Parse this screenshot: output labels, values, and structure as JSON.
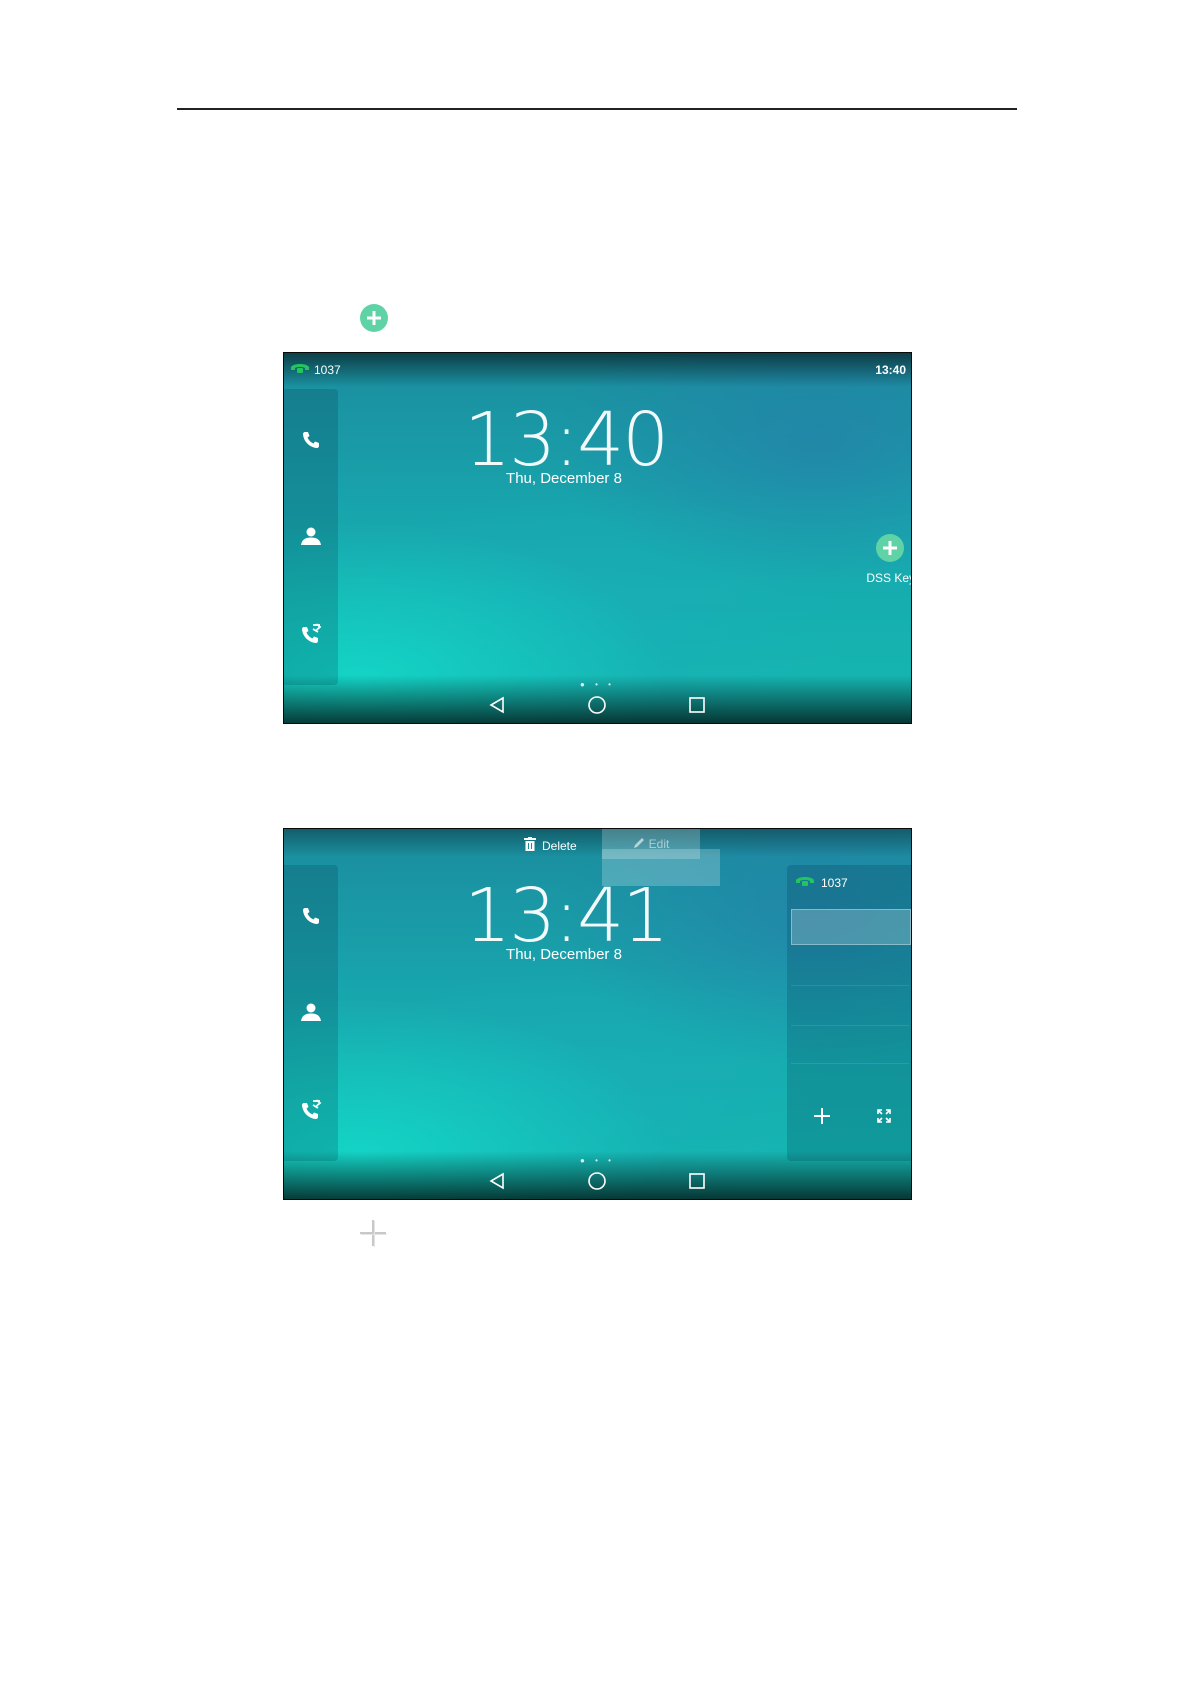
{
  "doc": {
    "inline_icon_1": "add-circle-icon",
    "inline_icon_2": "plus-icon"
  },
  "screen1": {
    "status": {
      "account": "1037",
      "time": "13:40"
    },
    "clock": "13:40",
    "date": "Thu, December 8",
    "dss_key_label": "DSS Key",
    "sidebar_icons": [
      "phone-icon",
      "contact-icon",
      "call-history-icon"
    ],
    "nav_icons": [
      "back-icon",
      "home-icon",
      "recent-apps-icon"
    ]
  },
  "screen2": {
    "delete_label": "Delete",
    "edit_label": "Edit",
    "clock": "13:41",
    "date": "Thu, December 8",
    "panel_account": "1037",
    "sidebar_icons": [
      "phone-icon",
      "contact-icon",
      "call-history-icon"
    ],
    "panel_buttons": [
      "plus-icon",
      "expand-icon"
    ],
    "nav_icons": [
      "back-icon",
      "home-icon",
      "recent-apps-icon"
    ]
  },
  "colors": {
    "accent_green": "#5fd3a6",
    "account_green": "#22c55e"
  }
}
